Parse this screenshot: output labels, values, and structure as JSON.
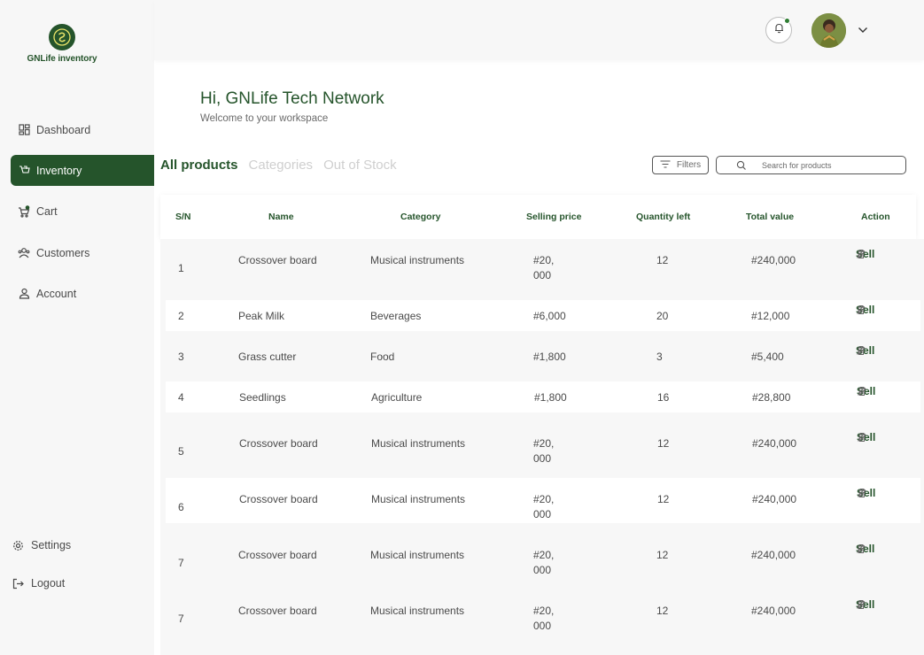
{
  "brand": {
    "name": "GNLife inventory",
    "accent": "#25542b"
  },
  "sidebar": {
    "items": [
      {
        "label": "Dashboard",
        "icon": "dashboard-icon"
      },
      {
        "label": "Inventory",
        "icon": "inventory-icon",
        "active": true
      },
      {
        "label": "Cart",
        "icon": "cart-icon"
      },
      {
        "label": "Customers",
        "icon": "customers-icon"
      },
      {
        "label": "Account",
        "icon": "account-icon"
      }
    ],
    "bottom": [
      {
        "label": "Settings",
        "icon": "gear-icon"
      },
      {
        "label": "Logout",
        "icon": "logout-icon"
      }
    ]
  },
  "header": {
    "greeting": "Hi, GNLife Tech Network",
    "subtitle": "Welcome to your workspace"
  },
  "tabs": [
    "All products",
    "Categories",
    "Out of Stock"
  ],
  "toolbar": {
    "filters_label": "Filters",
    "search_placeholder": "Search for products"
  },
  "table": {
    "columns": [
      "S/N",
      "Name",
      "Category",
      "Selling price",
      "Quantity left",
      "Total value",
      "Action"
    ],
    "action_label": "Sell",
    "rows": [
      {
        "sn": "1",
        "name": "Crossover board",
        "category": "Musical instruments",
        "price": "#20,\n000",
        "qty": "12",
        "total": "#240,000"
      },
      {
        "sn": "2",
        "name": "Peak Milk",
        "category": "Beverages",
        "price": "#6,000",
        "qty": "20",
        "total": "#12,000"
      },
      {
        "sn": "3",
        "name": "Grass cutter",
        "category": "Food",
        "price": "#1,800",
        "qty": "3",
        "total": "#5,400"
      },
      {
        "sn": "4",
        "name": "Seedlings",
        "category": "Agriculture",
        "price": "#1,800",
        "qty": "16",
        "total": "#28,800"
      },
      {
        "sn": "5",
        "name": "Crossover board",
        "category": "Musical instruments",
        "price": "#20,\n000",
        "qty": "12",
        "total": "#240,000"
      },
      {
        "sn": "6",
        "name": "Crossover board",
        "category": "Musical instruments",
        "price": "#20,\n000",
        "qty": "12",
        "total": "#240,000"
      },
      {
        "sn": "7",
        "name": "Crossover board",
        "category": "Musical instruments",
        "price": "#20,\n000",
        "qty": "12",
        "total": "#240,000"
      },
      {
        "sn": "7",
        "name": "Crossover board",
        "category": "Musical instruments",
        "price": "#20,\n000",
        "qty": "12",
        "total": "#240,000"
      }
    ]
  }
}
